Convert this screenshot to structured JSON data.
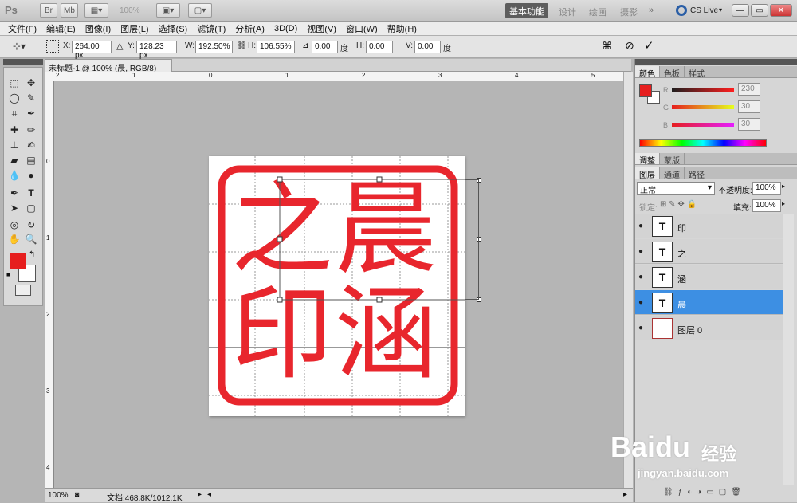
{
  "app": {
    "logo": "Ps",
    "zoom_display": "100%",
    "workspaces": [
      "基本功能",
      "设计",
      "绘画",
      "摄影"
    ],
    "cslive": "CS Live"
  },
  "menu": [
    "文件(F)",
    "编辑(E)",
    "图像(I)",
    "图层(L)",
    "选择(S)",
    "滤镜(T)",
    "分析(A)",
    "3D(D)",
    "视图(V)",
    "窗口(W)",
    "帮助(H)"
  ],
  "options": {
    "x_label": "X:",
    "x_value": "264.00 px",
    "y_label": "Y:",
    "y_value": "128.23 px",
    "w_label": "W:",
    "w_value": "192.50%",
    "h_label": "H:",
    "h_value": "106.55%",
    "angle_value": "0.00",
    "angle_unit": "度",
    "hskew_label": "H:",
    "hskew_value": "0.00",
    "vskew_label": "V:",
    "vskew_value": "0.00",
    "skew_unit": "度"
  },
  "document": {
    "tab_title": "未标题-1 @ 100% (晨, RGB/8) *",
    "close": "×"
  },
  "rulers": {
    "h_ticks": [
      "2",
      "1",
      "0",
      "1",
      "2",
      "3",
      "4",
      "5"
    ],
    "v_ticks": [
      "0",
      "1",
      "2",
      "3",
      "4"
    ]
  },
  "seal": {
    "chars": [
      "晨",
      "涵",
      "之",
      "印"
    ],
    "color": "#e8262d"
  },
  "status": {
    "zoom": "100%",
    "doc_info": "文档:468.8K/1012.1K"
  },
  "color_panel": {
    "tabs": [
      "颜色",
      "色板",
      "样式"
    ],
    "r_label": "R",
    "r_value": "230",
    "g_label": "G",
    "g_value": "30",
    "b_label": "B",
    "b_value": "30",
    "fg": "#e61e1e",
    "bg": "#ffffff"
  },
  "adjust_panel": {
    "tabs": [
      "调整",
      "蒙版"
    ]
  },
  "layers_panel": {
    "tabs": [
      "图层",
      "通道",
      "路径"
    ],
    "blend_mode": "正常",
    "opacity_label": "不透明度:",
    "opacity": "100%",
    "lock_label": "锁定:",
    "fill_label": "填充:",
    "fill": "100%",
    "layers": [
      {
        "name": "印",
        "type": "T"
      },
      {
        "name": "之",
        "type": "T"
      },
      {
        "name": "涵",
        "type": "T"
      },
      {
        "name": "晨",
        "type": "T",
        "selected": true
      },
      {
        "name": "图层 0",
        "type": "img"
      }
    ]
  },
  "watermark": {
    "brand": "Baidu",
    "brand_cn": "经验",
    "url": "jingyan.baidu.com"
  }
}
